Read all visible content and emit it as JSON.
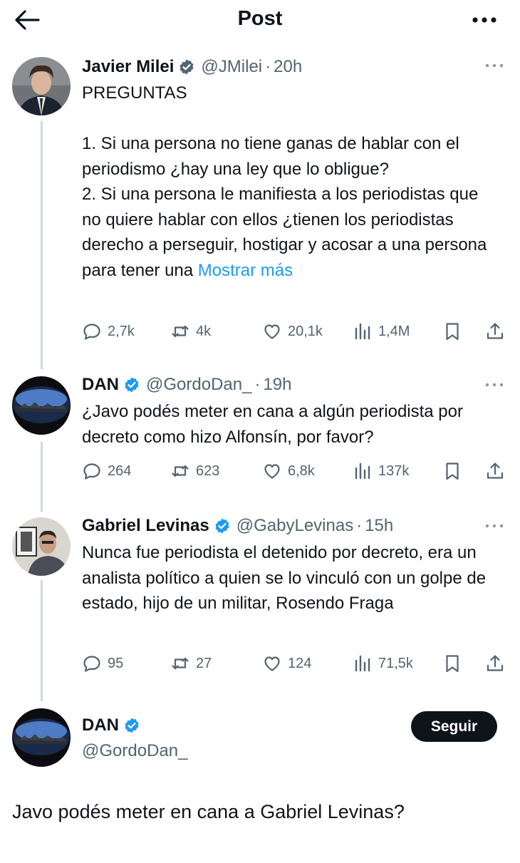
{
  "header": {
    "title": "Post"
  },
  "tweets": [
    {
      "name": "Javier Milei",
      "handle": "@JMilei",
      "dot": "·",
      "time": "20h",
      "text": "PREGUNTAS\n\n1. Si una persona no tiene ganas de hablar con el periodismo ¿hay una ley que lo obligue?\n2. Si una persona le manifiesta a los periodistas que no quiere hablar con ellos ¿tienen los periodistas derecho a perseguir, hostigar y acosar a una persona para tener una ",
      "show_more": "Mostrar más",
      "replies": "2,7k",
      "reposts": "4k",
      "likes": "20,1k",
      "views": "1,4M"
    },
    {
      "name": "DAN",
      "handle": "@GordoDan_",
      "dot": "·",
      "time": "19h",
      "text": "¿Javo podés meter en cana a algún periodista por decreto como hizo Alfonsín, por favor?",
      "replies": "264",
      "reposts": "623",
      "likes": "6,8k",
      "views": "137k"
    },
    {
      "name": "Gabriel Levinas",
      "handle": "@GabyLevinas",
      "dot": "·",
      "time": "15h",
      "text": "Nunca fue periodista el detenido por decreto, era un analista político a quien se lo vinculó con un golpe de estado, hijo de un militar, Rosendo Fraga",
      "replies": "95",
      "reposts": "27",
      "likes": "124",
      "views": "71,5k"
    }
  ],
  "main_tweet": {
    "name": "DAN",
    "handle": "@GordoDan_",
    "follow_label": "Seguir",
    "text": "Javo podés meter en cana a Gabriel Levinas?"
  },
  "colors": {
    "accent": "#1d9bf0",
    "verified": "#1d9bf0",
    "muted": "#536471",
    "line": "#cfd9de"
  }
}
